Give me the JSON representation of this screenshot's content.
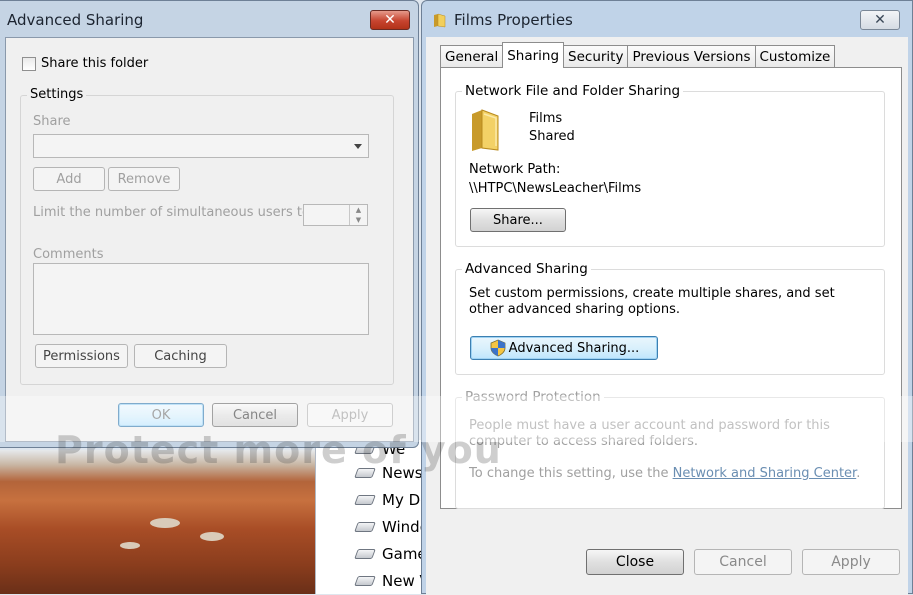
{
  "advanced_sharing_dialog": {
    "title": "Advanced Sharing",
    "close_glyph": "✕",
    "share_checkbox_label": "Share this folder",
    "settings_label": "Settings",
    "share_label": "Share",
    "share_value": "",
    "add_label": "Add",
    "remove_label": "Remove",
    "limit_label": "Limit the number of simultaneous users to:",
    "limit_value": "",
    "comments_label": "Comments",
    "comments_value": "",
    "permissions_label": "Permissions",
    "caching_label": "Caching",
    "ok_label": "OK",
    "cancel_label": "Cancel",
    "apply_label": "Apply"
  },
  "films_properties": {
    "title": "Films Properties",
    "close_glyph": "✕",
    "tabs": [
      {
        "label": "General"
      },
      {
        "label": "Sharing"
      },
      {
        "label": "Security"
      },
      {
        "label": "Previous Versions"
      },
      {
        "label": "Customize"
      }
    ],
    "active_tab": "Sharing",
    "network_sharing": {
      "heading": "Network File and Folder Sharing",
      "folder_name": "Films",
      "folder_status": "Shared",
      "network_path_label": "Network Path:",
      "network_path": "\\\\HTPC\\NewsLeacher\\Films",
      "share_button": "Share..."
    },
    "advanced_sharing": {
      "heading": "Advanced Sharing",
      "description": "Set custom permissions, create multiple shares, and set other advanced sharing options.",
      "button": "Advanced Sharing..."
    },
    "password_protection": {
      "heading": "Password Protection",
      "description": "People must have a user account and password for this computer to access shared folders.",
      "change_prefix": "To change this setting, use the ",
      "link_text": "Network and Sharing Center",
      "change_suffix": "."
    },
    "buttons": {
      "close": "Close",
      "cancel": "Cancel",
      "apply": "Apply"
    }
  },
  "background": {
    "explorer_items": [
      {
        "label": "We"
      },
      {
        "label": "Newsl"
      },
      {
        "label": "My Do"
      },
      {
        "label": "Windo"
      },
      {
        "label": "Game"
      },
      {
        "label": "New V"
      }
    ],
    "watermark": "Protect more of you"
  },
  "colors": {
    "window_frame": "#c0d3e8",
    "close_red": "#c7442f",
    "link": "#6a8eb2",
    "focus_button": "#bee6fd"
  }
}
